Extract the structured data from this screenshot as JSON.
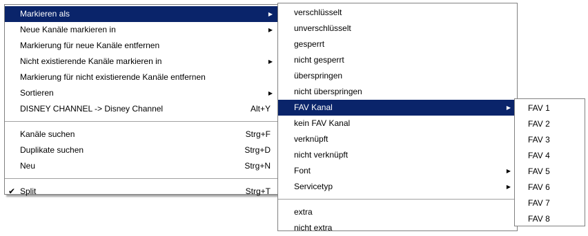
{
  "main_menu": {
    "items": [
      {
        "label": "Markieren als",
        "submenu": true,
        "highlighted": true
      },
      {
        "label": "Neue Kanäle markieren in",
        "submenu": true
      },
      {
        "label": "Markierung für neue Kanäle entfernen"
      },
      {
        "label": "Nicht existierende Kanäle markieren in",
        "submenu": true
      },
      {
        "label": "Markierung für nicht existierende Kanäle entfernen"
      },
      {
        "label": "Sortieren",
        "submenu": true
      },
      {
        "label": "DISNEY CHANNEL -> Disney Channel",
        "shortcut": "Alt+Y"
      },
      {
        "label": "Kanäle suchen",
        "shortcut": "Strg+F"
      },
      {
        "label": "Duplikate suchen",
        "shortcut": "Strg+D"
      },
      {
        "label": "Neu",
        "shortcut": "Strg+N"
      },
      {
        "label": "Split",
        "shortcut": "Strg+T",
        "checked": true
      }
    ]
  },
  "mark_submenu": {
    "items": [
      {
        "label": "verschlüsselt"
      },
      {
        "label": "unverschlüsselt"
      },
      {
        "label": "gesperrt"
      },
      {
        "label": "nicht gesperrt"
      },
      {
        "label": "überspringen"
      },
      {
        "label": "nicht überspringen"
      },
      {
        "label": "FAV Kanal",
        "submenu": true,
        "highlighted": true
      },
      {
        "label": "kein FAV Kanal"
      },
      {
        "label": "verknüpft"
      },
      {
        "label": "nicht verknüpft"
      },
      {
        "label": "Font",
        "submenu": true
      },
      {
        "label": "Servicetyp",
        "submenu": true
      },
      {
        "label": "extra"
      },
      {
        "label": "nicht extra"
      }
    ]
  },
  "fav_submenu": {
    "items": [
      {
        "label": "FAV 1"
      },
      {
        "label": "FAV 2"
      },
      {
        "label": "FAV 3"
      },
      {
        "label": "FAV 4"
      },
      {
        "label": "FAV 5"
      },
      {
        "label": "FAV 6"
      },
      {
        "label": "FAV 7"
      },
      {
        "label": "FAV 8"
      }
    ]
  },
  "icons": {
    "submenu_arrow": "triangle-right",
    "check": "checkmark"
  },
  "colors": {
    "highlight_bg": "#0a246a",
    "highlight_text": "#ffffff",
    "menu_bg": "#ffffff"
  }
}
